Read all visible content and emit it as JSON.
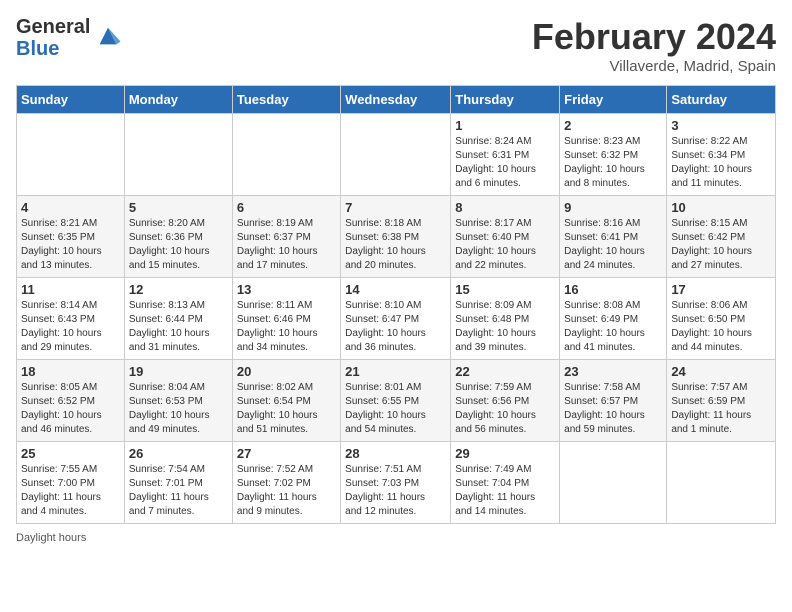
{
  "header": {
    "logo_general": "General",
    "logo_blue": "Blue",
    "month_year": "February 2024",
    "location": "Villaverde, Madrid, Spain"
  },
  "calendar": {
    "days_of_week": [
      "Sunday",
      "Monday",
      "Tuesday",
      "Wednesday",
      "Thursday",
      "Friday",
      "Saturday"
    ],
    "weeks": [
      [
        {
          "day": "",
          "info": ""
        },
        {
          "day": "",
          "info": ""
        },
        {
          "day": "",
          "info": ""
        },
        {
          "day": "",
          "info": ""
        },
        {
          "day": "1",
          "info": "Sunrise: 8:24 AM\nSunset: 6:31 PM\nDaylight: 10 hours\nand 6 minutes."
        },
        {
          "day": "2",
          "info": "Sunrise: 8:23 AM\nSunset: 6:32 PM\nDaylight: 10 hours\nand 8 minutes."
        },
        {
          "day": "3",
          "info": "Sunrise: 8:22 AM\nSunset: 6:34 PM\nDaylight: 10 hours\nand 11 minutes."
        }
      ],
      [
        {
          "day": "4",
          "info": "Sunrise: 8:21 AM\nSunset: 6:35 PM\nDaylight: 10 hours\nand 13 minutes."
        },
        {
          "day": "5",
          "info": "Sunrise: 8:20 AM\nSunset: 6:36 PM\nDaylight: 10 hours\nand 15 minutes."
        },
        {
          "day": "6",
          "info": "Sunrise: 8:19 AM\nSunset: 6:37 PM\nDaylight: 10 hours\nand 17 minutes."
        },
        {
          "day": "7",
          "info": "Sunrise: 8:18 AM\nSunset: 6:38 PM\nDaylight: 10 hours\nand 20 minutes."
        },
        {
          "day": "8",
          "info": "Sunrise: 8:17 AM\nSunset: 6:40 PM\nDaylight: 10 hours\nand 22 minutes."
        },
        {
          "day": "9",
          "info": "Sunrise: 8:16 AM\nSunset: 6:41 PM\nDaylight: 10 hours\nand 24 minutes."
        },
        {
          "day": "10",
          "info": "Sunrise: 8:15 AM\nSunset: 6:42 PM\nDaylight: 10 hours\nand 27 minutes."
        }
      ],
      [
        {
          "day": "11",
          "info": "Sunrise: 8:14 AM\nSunset: 6:43 PM\nDaylight: 10 hours\nand 29 minutes."
        },
        {
          "day": "12",
          "info": "Sunrise: 8:13 AM\nSunset: 6:44 PM\nDaylight: 10 hours\nand 31 minutes."
        },
        {
          "day": "13",
          "info": "Sunrise: 8:11 AM\nSunset: 6:46 PM\nDaylight: 10 hours\nand 34 minutes."
        },
        {
          "day": "14",
          "info": "Sunrise: 8:10 AM\nSunset: 6:47 PM\nDaylight: 10 hours\nand 36 minutes."
        },
        {
          "day": "15",
          "info": "Sunrise: 8:09 AM\nSunset: 6:48 PM\nDaylight: 10 hours\nand 39 minutes."
        },
        {
          "day": "16",
          "info": "Sunrise: 8:08 AM\nSunset: 6:49 PM\nDaylight: 10 hours\nand 41 minutes."
        },
        {
          "day": "17",
          "info": "Sunrise: 8:06 AM\nSunset: 6:50 PM\nDaylight: 10 hours\nand 44 minutes."
        }
      ],
      [
        {
          "day": "18",
          "info": "Sunrise: 8:05 AM\nSunset: 6:52 PM\nDaylight: 10 hours\nand 46 minutes."
        },
        {
          "day": "19",
          "info": "Sunrise: 8:04 AM\nSunset: 6:53 PM\nDaylight: 10 hours\nand 49 minutes."
        },
        {
          "day": "20",
          "info": "Sunrise: 8:02 AM\nSunset: 6:54 PM\nDaylight: 10 hours\nand 51 minutes."
        },
        {
          "day": "21",
          "info": "Sunrise: 8:01 AM\nSunset: 6:55 PM\nDaylight: 10 hours\nand 54 minutes."
        },
        {
          "day": "22",
          "info": "Sunrise: 7:59 AM\nSunset: 6:56 PM\nDaylight: 10 hours\nand 56 minutes."
        },
        {
          "day": "23",
          "info": "Sunrise: 7:58 AM\nSunset: 6:57 PM\nDaylight: 10 hours\nand 59 minutes."
        },
        {
          "day": "24",
          "info": "Sunrise: 7:57 AM\nSunset: 6:59 PM\nDaylight: 11 hours\nand 1 minute."
        }
      ],
      [
        {
          "day": "25",
          "info": "Sunrise: 7:55 AM\nSunset: 7:00 PM\nDaylight: 11 hours\nand 4 minutes."
        },
        {
          "day": "26",
          "info": "Sunrise: 7:54 AM\nSunset: 7:01 PM\nDaylight: 11 hours\nand 7 minutes."
        },
        {
          "day": "27",
          "info": "Sunrise: 7:52 AM\nSunset: 7:02 PM\nDaylight: 11 hours\nand 9 minutes."
        },
        {
          "day": "28",
          "info": "Sunrise: 7:51 AM\nSunset: 7:03 PM\nDaylight: 11 hours\nand 12 minutes."
        },
        {
          "day": "29",
          "info": "Sunrise: 7:49 AM\nSunset: 7:04 PM\nDaylight: 11 hours\nand 14 minutes."
        },
        {
          "day": "",
          "info": ""
        },
        {
          "day": "",
          "info": ""
        }
      ]
    ]
  },
  "footer": {
    "text": "Daylight hours"
  }
}
